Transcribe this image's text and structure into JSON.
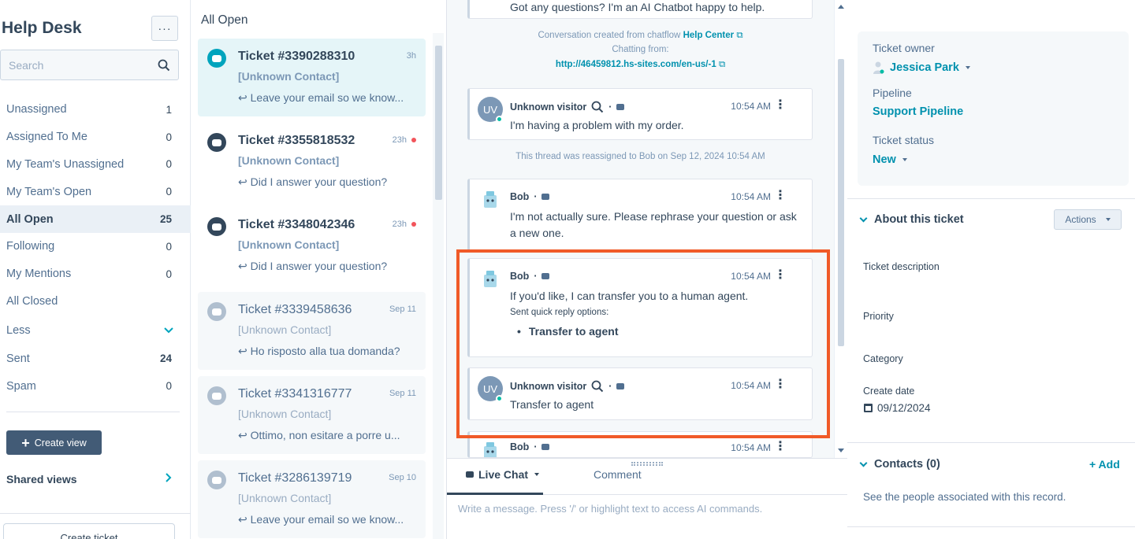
{
  "sidebar": {
    "title": "Help Desk",
    "more_label": "···",
    "search_placeholder": "Search",
    "views": [
      {
        "label": "Unassigned",
        "count": "1"
      },
      {
        "label": "Assigned To Me",
        "count": "0"
      },
      {
        "label": "My Team's Unassigned",
        "count": "0"
      },
      {
        "label": "My Team's Open",
        "count": "0"
      },
      {
        "label": "All Open",
        "count": "25"
      },
      {
        "label": "Following",
        "count": "0"
      },
      {
        "label": "My Mentions",
        "count": "0"
      },
      {
        "label": "All Closed",
        "count": ""
      }
    ],
    "less_label": "Less",
    "sent": {
      "label": "Sent",
      "count": "24"
    },
    "spam": {
      "label": "Spam",
      "count": "0"
    },
    "create_view_label": "Create view",
    "shared_views_label": "Shared views",
    "create_ticket_label": "Create ticket"
  },
  "ticket_list": {
    "title": "All Open",
    "tickets": [
      {
        "number": "Ticket #3390288310",
        "time": "3h",
        "contact": "[Unknown Contact]",
        "preview": "Leave your email so we know..."
      },
      {
        "number": "Ticket #3355818532",
        "time": "23h",
        "contact": "[Unknown Contact]",
        "preview": "Did I answer your question?"
      },
      {
        "number": "Ticket #3348042346",
        "time": "23h",
        "contact": "[Unknown Contact]",
        "preview": "Did I answer your question?"
      },
      {
        "number": "Ticket #3339458636",
        "time": "Sep 11",
        "contact": "[Unknown Contact]",
        "preview": "Ho risposto alla tua domanda?"
      },
      {
        "number": "Ticket #3341316777",
        "time": "Sep 11",
        "contact": "[Unknown Contact]",
        "preview": "Ottimo, non esitare a porre u..."
      },
      {
        "number": "Ticket #3286139719",
        "time": "Sep 10",
        "contact": "[Unknown Contact]",
        "preview": "Leave your email so we know..."
      }
    ]
  },
  "conversation": {
    "top_message": "Got any questions? I'm an AI Chatbot happy to help.",
    "created_from_prefix": "Conversation created from chatflow",
    "created_from_link": "Help Center",
    "chatting_from_label": "Chatting from:",
    "chatting_from_url": "http://46459812.hs-sites.com/en-us/-1",
    "reassigned_note": "This thread was reassigned to Bob on Sep 12, 2024 10:54 AM",
    "messages": [
      {
        "sender": "Unknown visitor",
        "avatar": "UV",
        "time": "10:54 AM",
        "text": "I'm having a problem with my order."
      },
      {
        "sender": "Bob",
        "time": "10:54 AM",
        "text": "I'm not actually sure. Please rephrase your question or ask a new one."
      },
      {
        "sender": "Bob",
        "time": "10:54 AM",
        "text": "If you'd like, I can transfer you to a human agent.",
        "quick_label": "Sent quick reply options:",
        "quick_option": "Transfer to agent"
      },
      {
        "sender": "Unknown visitor",
        "avatar": "UV",
        "time": "10:54 AM",
        "text": "Transfer to agent"
      },
      {
        "sender": "Bob",
        "time": "10:54 AM",
        "text": ""
      }
    ],
    "composer": {
      "live_chat_label": "Live Chat",
      "comment_label": "Comment",
      "placeholder": "Write a message. Press '/' or highlight text to access AI commands."
    },
    "highlight_color": "#f05a28"
  },
  "right_panel": {
    "ticket_owner_label": "Ticket owner",
    "ticket_owner_value": "Jessica Park",
    "pipeline_label": "Pipeline",
    "pipeline_value": "Support Pipeline",
    "status_label": "Ticket status",
    "status_value": "New",
    "about_title": "About this ticket",
    "actions_label": "Actions",
    "description_label": "Ticket description",
    "priority_label": "Priority",
    "category_label": "Category",
    "create_date_label": "Create date",
    "create_date_value": "09/12/2024",
    "contacts_title": "Contacts (0)",
    "add_label": "+ Add",
    "contacts_desc": "See the people associated with this record."
  }
}
